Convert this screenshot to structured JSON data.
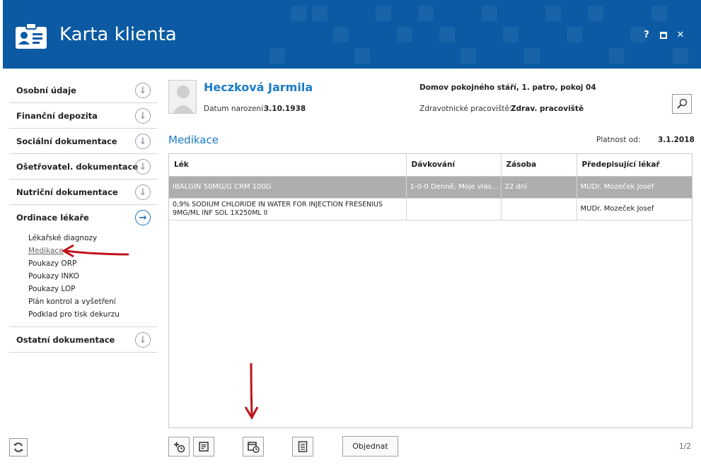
{
  "window": {
    "title": "Karta klienta",
    "help_label": "?",
    "close_label": "✕",
    "brand_color": "#0b5aa3"
  },
  "sidebar": {
    "items": [
      {
        "label": "Osobní údaje"
      },
      {
        "label": "Finanční depozita"
      },
      {
        "label": "Sociální dokumentace"
      },
      {
        "label": "Ošetřovatel. dokumentace"
      },
      {
        "label": "Nutriční dokumentace"
      },
      {
        "label": "Ordinace lékaře"
      },
      {
        "label": "Ostatní dokumentace"
      }
    ],
    "sub_items": [
      {
        "label": "Lékařské diagnozy"
      },
      {
        "label": "Medikace"
      },
      {
        "label": "Poukazy ORP"
      },
      {
        "label": "Poukazy INKO"
      },
      {
        "label": "Poukazy LOP"
      },
      {
        "label": "Plán kontrol a vyšetření"
      },
      {
        "label": "Podklad pro tisk dekurzu"
      }
    ]
  },
  "patient": {
    "name": "Heczková Jarmila",
    "dob_label": "Datum narození:",
    "dob": "3.10.1938",
    "location": "Domov pokojného stáří, 1. patro, pokoj 04",
    "workplace_label": "Zdravotnické pracoviště:",
    "workplace": "Zdrav. pracoviště"
  },
  "section": {
    "title": "Medikace",
    "valid_label": "Platnost od:",
    "valid_from": "3.1.2018"
  },
  "table": {
    "headers": [
      "Lék",
      "Dávkování",
      "Zásoba",
      "Předepisující lékař"
    ],
    "rows": [
      {
        "drug": "IBALGIN 50MG/G CRM 100G",
        "dosage": "1-0-0 Denně, Moje vlas...",
        "stock": "22 dní",
        "doctor": "MUDr. Mozeček Josef"
      },
      {
        "drug": "0,9% SODIUM CHLORIDE IN WATER FOR INJECTION FRESENIUS 9MG/ML INF SOL 1X250ML II",
        "dosage": "",
        "stock": "",
        "doctor": "MUDr. Mozeček Josef"
      }
    ]
  },
  "toolbar": {
    "order_label": "Objednat",
    "page_indicator": "1/2",
    "icons": [
      "add-schedule-icon",
      "notes-icon",
      "calendar-history-icon",
      "document-icon"
    ]
  },
  "annotations": {
    "arrow_color": "#c0141c"
  }
}
